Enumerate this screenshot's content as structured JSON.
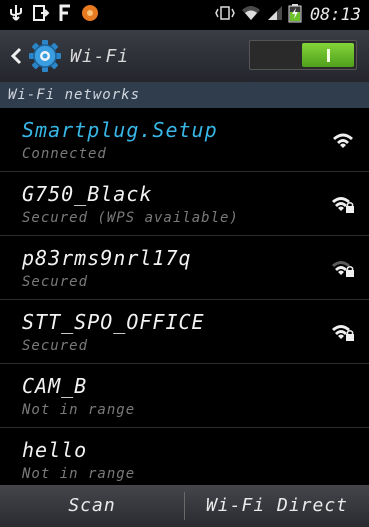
{
  "status_bar": {
    "time": "08:13",
    "icons": [
      "usb-icon",
      "file-transfer-icon",
      "facebook-icon",
      "notification-icon",
      "vibrate-icon",
      "wifi-signal-icon",
      "cell-signal-icon",
      "battery-charging-icon"
    ]
  },
  "header": {
    "title": "Wi-Fi",
    "toggle_state": "on"
  },
  "section": {
    "label": "Wi-Fi networks"
  },
  "networks": [
    {
      "ssid": "Smartplug.Setup",
      "status": "Connected",
      "secured": false,
      "connected": true
    },
    {
      "ssid": "G750_Black",
      "status": "Secured (WPS available)",
      "secured": true,
      "connected": false
    },
    {
      "ssid": "p83rms9nrl17q",
      "status": "Secured",
      "secured": true,
      "connected": false
    },
    {
      "ssid": "STT_SPO_OFFICE",
      "status": "Secured",
      "secured": true,
      "connected": false
    },
    {
      "ssid": "CAM_B",
      "status": "Not in range",
      "secured": false,
      "connected": false
    },
    {
      "ssid": "hello",
      "status": "Not in range",
      "secured": false,
      "connected": false
    }
  ],
  "bottom": {
    "scan_label": "Scan",
    "direct_label": "Wi-Fi Direct"
  },
  "colors": {
    "accent_blue": "#38b6e6",
    "toggle_green": "#6cc02a",
    "section_bg": "#2f3d4d"
  }
}
